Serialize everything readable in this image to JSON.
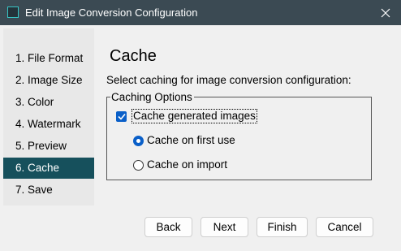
{
  "window": {
    "title": "Edit Image Conversion Configuration",
    "accent_color": "#16505c",
    "titlebar_color": "#3b4a53"
  },
  "sidebar": {
    "items": [
      {
        "label": "1. File Format",
        "selected": false
      },
      {
        "label": "2. Image Size",
        "selected": false
      },
      {
        "label": "3. Color",
        "selected": false
      },
      {
        "label": "4. Watermark",
        "selected": false
      },
      {
        "label": "5. Preview",
        "selected": false
      },
      {
        "label": "6. Cache",
        "selected": true
      },
      {
        "label": "7. Save",
        "selected": false
      }
    ]
  },
  "main": {
    "title": "Cache",
    "description": "Select caching for image conversion configuration:",
    "group": {
      "legend": "Caching Options",
      "checkbox": {
        "label": "Cache generated images",
        "checked": true
      },
      "radios": [
        {
          "label": "Cache on first use",
          "selected": true
        },
        {
          "label": "Cache on import",
          "selected": false
        }
      ]
    }
  },
  "buttons": {
    "back": "Back",
    "next": "Next",
    "finish": "Finish",
    "cancel": "Cancel"
  },
  "icons": {
    "app": "app-icon",
    "close": "close-icon",
    "check": "checkmark-icon"
  }
}
